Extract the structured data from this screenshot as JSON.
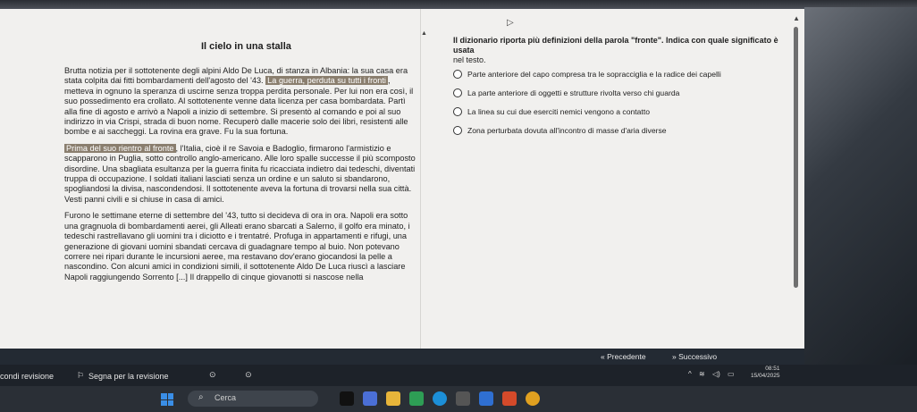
{
  "story": {
    "title": "Il cielo in una stalla",
    "p1": [
      {
        "text": "Brutta notizia per il sottotenente degli alpini Aldo De Luca, di stanza in Albania: la sua casa era stata colpita dai fitti bombardamenti dell'agosto del '43. "
      },
      {
        "text": "La guerra, perduta su tutti i fronti",
        "highlight": true
      },
      {
        "text": ", metteva in ognuno la speranza di uscirne senza troppa perdita personale. Per lui non era così, il suo possedimento era crollato. Al sottotenente venne data licenza per casa bombardata. Partì alla fine di agosto e arrivò a Napoli a inizio di settembre. Si presentò al comando e poi al suo indirizzo in via Crispi, strada di buon nome. Recuperò dalle macerie solo dei libri, resistenti alle bombe e ai saccheggi. La rovina era grave. Fu la sua fortuna."
      }
    ],
    "p2": [
      {
        "text": "Prima del suo rientro al fronte",
        "highlight": true
      },
      {
        "text": ", l'Italia, cioè il re Savoia e Badoglio, firmarono l'armistizio e scapparono in Puglia, sotto controllo anglo-americano. Alle loro spalle successe il più scomposto disordine. Una sbagliata esultanza per la guerra finita fu ricacciata indietro dai tedeschi, diventati truppa di occupazione. I soldati italiani lasciati senza un ordine e un saluto si sbandarono, spogliandosi la divisa, nascondendosi. Il sottotenente aveva la fortuna di trovarsi nella sua città. Vesti panni civili e si chiuse in casa di amici."
      }
    ],
    "p3": "Furono le settimane eterne di settembre del '43, tutto si decideva di ora in ora. Napoli era sotto una gragnuola di bombardamenti aerei, gli Alleati erano sbarcati a Salerno, il golfo era minato, i tedeschi rastrellavano gli uomini tra i diciotto e i trentatré. Profuga in appartamenti e rifugi, una generazione di giovani uomini sbandati cercava di guadagnare tempo al buio. Non potevano correre nei ripari durante le incursioni aeree, ma restavano dov'erano giocandosi la pelle a nascondino. Con alcuni amici in condizioni simili, il sottotenente Aldo De Luca riuscì a lasciare Napoli raggiungendo Sorrento [...] Il drappello di cinque giovanotti si nascose nella"
  },
  "question": {
    "text": "Il dizionario riporta più definizioni della parola \"fronte\". Indica con quale significato è usata",
    "sub": "nel testo.",
    "options": [
      "Parte anteriore del capo compresa tra le sopracciglia e la radice dei capelli",
      "La parte anteriore di oggetti e strutture rivolta verso chi guarda",
      "La linea su cui due eserciti nemici vengono a contatto",
      "Zona perturbata dovuta all'incontro di masse d'aria diverse"
    ]
  },
  "nav": {
    "prev_label": "Precedente",
    "next_label": "Successivo"
  },
  "revision": {
    "left_label": "condi revisione",
    "flag_label": "Segna per la revisione"
  },
  "tray": {
    "time": "08:51",
    "date": "15/04/2025"
  },
  "taskbar": {
    "search_placeholder": "Cerca"
  }
}
